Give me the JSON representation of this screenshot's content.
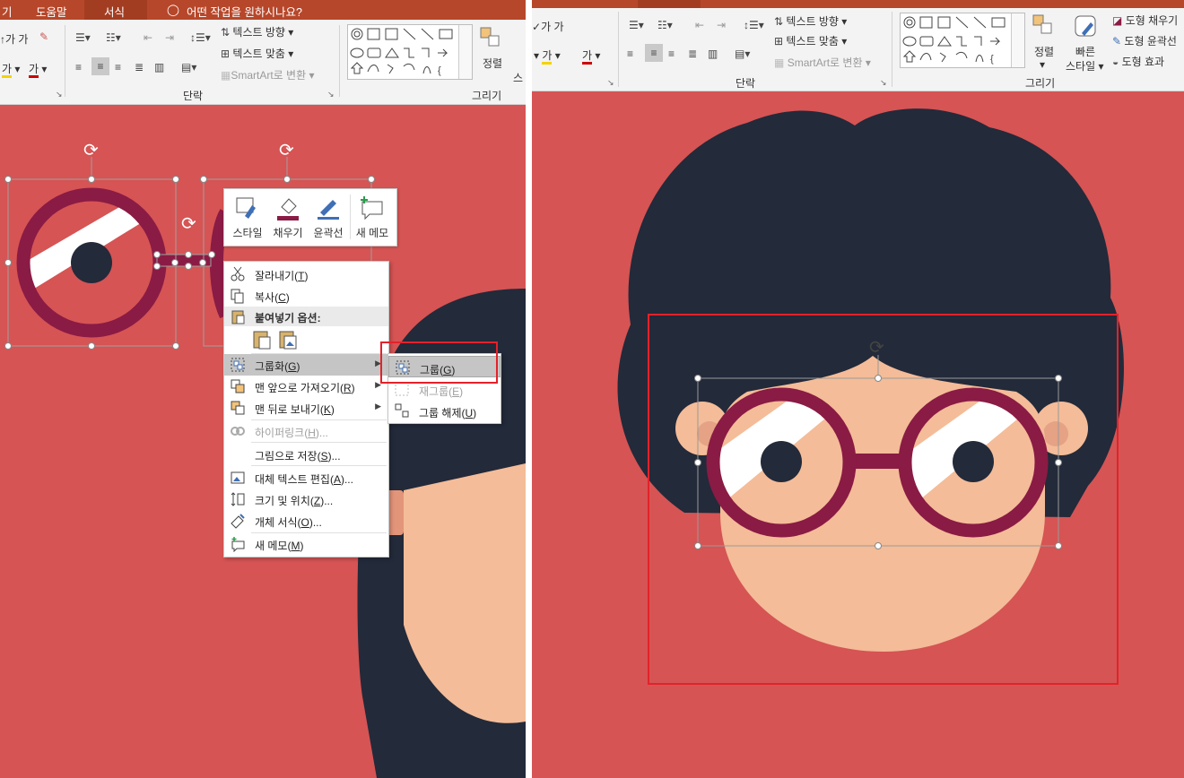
{
  "left": {
    "tabs": [
      {
        "label": "기"
      },
      {
        "label": "도움말"
      },
      {
        "label": "서식"
      },
      {
        "label": "어떤 작업을 원하시나요?"
      }
    ],
    "ribbon": {
      "font_row": [
        "가",
        "가"
      ],
      "font_color_labels": [
        "가",
        "가"
      ],
      "text_direction": "텍스트 방향",
      "align_text": "텍스트 맞춤",
      "smartart": "SmartArt로 변환",
      "paragraph_group": "단락",
      "arrange": "정렬",
      "drawing_group": "그리기",
      "quick_styles_partial": "스"
    },
    "minibar": [
      {
        "label": "스타일",
        "icon": "shape-style-icon"
      },
      {
        "label": "채우기",
        "icon": "paint-bucket-icon"
      },
      {
        "label": "윤곽선",
        "icon": "pen-outline-icon"
      },
      {
        "label": "새 메모",
        "icon": "new-comment-icon"
      }
    ],
    "context_menu": {
      "cut": {
        "label": "잘라내기(",
        "key": "T",
        "tail": ")"
      },
      "copy": {
        "label": "복사(",
        "key": "C",
        "tail": ")"
      },
      "paste_header": "붙여넣기 옵션:",
      "group": {
        "label": "그룹화(",
        "key": "G",
        "tail": ")"
      },
      "bring_front": {
        "label": "맨 앞으로 가져오기(",
        "key": "R",
        "tail": ")"
      },
      "send_back": {
        "label": "맨 뒤로 보내기(",
        "key": "K",
        "tail": ")"
      },
      "hyperlink": {
        "label": "하이퍼링크(",
        "key": "H",
        "tail": ")..."
      },
      "save_picture": {
        "label": "그림으로 저장(",
        "key": "S",
        "tail": ")..."
      },
      "alt_text": {
        "label": "대체 텍스트 편집(",
        "key": "A",
        "tail": ")..."
      },
      "size_position": {
        "label": "크기 및 위치(",
        "key": "Z",
        "tail": ")..."
      },
      "format_object": {
        "label": "개체 서식(",
        "key": "O",
        "tail": ")..."
      },
      "new_comment": {
        "label": "새 메모(",
        "key": "M",
        "tail": ")"
      }
    },
    "submenu": {
      "group": {
        "label": "그룹(",
        "key": "G",
        "tail": ")"
      },
      "regroup": {
        "label": "재그룹(",
        "key": "E",
        "tail": ")"
      },
      "ungroup": {
        "label": "그룹 해제(",
        "key": "U",
        "tail": ")"
      }
    }
  },
  "right": {
    "ribbon": {
      "font_row": [
        "가",
        "가"
      ],
      "font_color_labels": [
        "가",
        "가"
      ],
      "text_direction": "텍스트 방향",
      "align_text": "텍스트 맞춤",
      "smartart": "SmartArt로 변환",
      "paragraph_group": "단락",
      "arrange": "정렬",
      "quick_styles": [
        "빠른",
        "스타일"
      ],
      "drawing_group": "그리기",
      "shape_fill": "도형 채우기",
      "shape_outline": "도형 윤곽선",
      "shape_effects": "도형 효과"
    }
  },
  "colors": {
    "slide_bg": "#d65454",
    "ribbon_tab": "#b7472a",
    "hair": "#232a3a",
    "skin": "#f4bc98",
    "glasses": "#8a1b44",
    "highlight_box": "#e3222a"
  }
}
